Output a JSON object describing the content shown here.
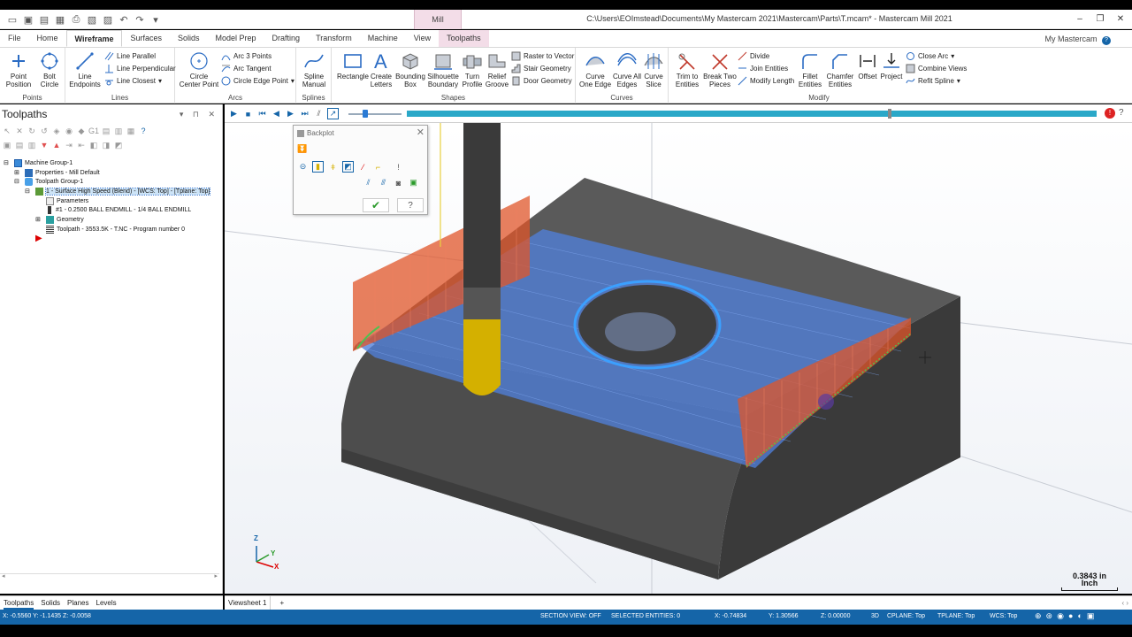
{
  "window": {
    "title": "C:\\Users\\EOImstead\\Documents\\My Mastercam 2021\\Mastercam\\Parts\\T.mcam* - Mastercam Mill 2021",
    "context_tab": "Mill",
    "my_mastercam": "My Mastercam"
  },
  "tabs": [
    "File",
    "Home",
    "Wireframe",
    "Surfaces",
    "Solids",
    "Model Prep",
    "Drafting",
    "Transform",
    "Machine",
    "View",
    "Toolpaths"
  ],
  "ribbon": {
    "points": {
      "label": "Points",
      "point_position": "Point\nPosition",
      "bolt_circle": "Bolt\nCircle"
    },
    "lines": {
      "label": "Lines",
      "line_endpoints": "Line\nEndpoints",
      "line_parallel": "Line Parallel",
      "line_perpendicular": "Line Perpendicular",
      "line_closest": "Line Closest"
    },
    "arcs": {
      "label": "Arcs",
      "circle_center_point": "Circle\nCenter Point",
      "arc_3_points": "Arc 3 Points",
      "arc_tangent": "Arc Tangent",
      "circle_edge_point": "Circle Edge Point"
    },
    "splines": {
      "label": "Splines",
      "spline_manual": "Spline\nManual"
    },
    "shapes": {
      "label": "Shapes",
      "rectangle": "Rectangle",
      "create_letters": "Create\nLetters",
      "bounding_box": "Bounding\nBox",
      "silhouette_boundary": "Silhouette\nBoundary",
      "turn_profile": "Turn\nProfile",
      "relief_groove": "Relief\nGroove",
      "raster_to_vector": "Raster to Vector",
      "stair_geometry": "Stair Geometry",
      "door_geometry": "Door Geometry"
    },
    "curves": {
      "label": "Curves",
      "curve_one_edge": "Curve\nOne Edge",
      "curve_all_edges": "Curve All\nEdges",
      "curve_slice": "Curve\nSlice"
    },
    "modify": {
      "label": "Modify",
      "trim_to_entities": "Trim to\nEntities",
      "break_two_pieces": "Break Two\nPieces",
      "divide": "Divide",
      "join_entities": "Join Entities",
      "modify_length": "Modify Length",
      "fillet_entities": "Fillet\nEntities",
      "chamfer_entities": "Chamfer\nEntities",
      "offset": "Offset",
      "project": "Project",
      "close_arc": "Close Arc",
      "combine_views": "Combine Views",
      "refit_spline": "Refit Spline"
    }
  },
  "toolpaths_panel": {
    "title": "Toolpaths",
    "tree": [
      {
        "text": "Machine Group-1",
        "level": 0
      },
      {
        "text": "Properties - Mill Default",
        "level": 1
      },
      {
        "text": "Toolpath Group-1",
        "level": 1
      },
      {
        "text": "1 - Surface High Speed (Blend) - [WCS: Top] - [Tplane: Top]",
        "level": 2
      },
      {
        "text": "Parameters",
        "level": 3
      },
      {
        "text": "#1 - 0.2500 BALL ENDMILL - 1/4 BALL ENDMILL",
        "level": 3
      },
      {
        "text": "Geometry",
        "level": 3
      },
      {
        "text": "Toolpath - 3553.5K - T.NC - Program number 0",
        "level": 3
      }
    ],
    "bottom_tabs": [
      "Toolpaths",
      "Solids",
      "Planes",
      "Levels"
    ]
  },
  "backplot": {
    "title": "Backplot"
  },
  "viewsheet": {
    "tab": "Viewsheet 1",
    "add": "+"
  },
  "scale": {
    "value": "0.3843 in",
    "unit": "Inch"
  },
  "axes": {
    "z": "Z",
    "y": "Y",
    "x": "X"
  },
  "status": {
    "cursor": "X: -0.5560   Y: -1.1435   Z: -0.0058",
    "section_view": "SECTION VIEW: OFF",
    "selected": "SELECTED ENTITIES: 0",
    "x": "X:   -0.74834",
    "y": "Y:   1.30566",
    "z": "Z:   0.00000",
    "mode": "3D",
    "cplane": "CPLANE: Top",
    "tplane": "TPLANE: Top",
    "wcs": "WCS: Top"
  },
  "colors": {
    "accent": "#1565a8",
    "toolpath": "#3c7be8",
    "rapid": "#e0562a",
    "tool_holder": "#3a3a3a",
    "tool_cutter": "#d4b000",
    "part": "#4a4a4a",
    "context": "#f3dde8"
  }
}
